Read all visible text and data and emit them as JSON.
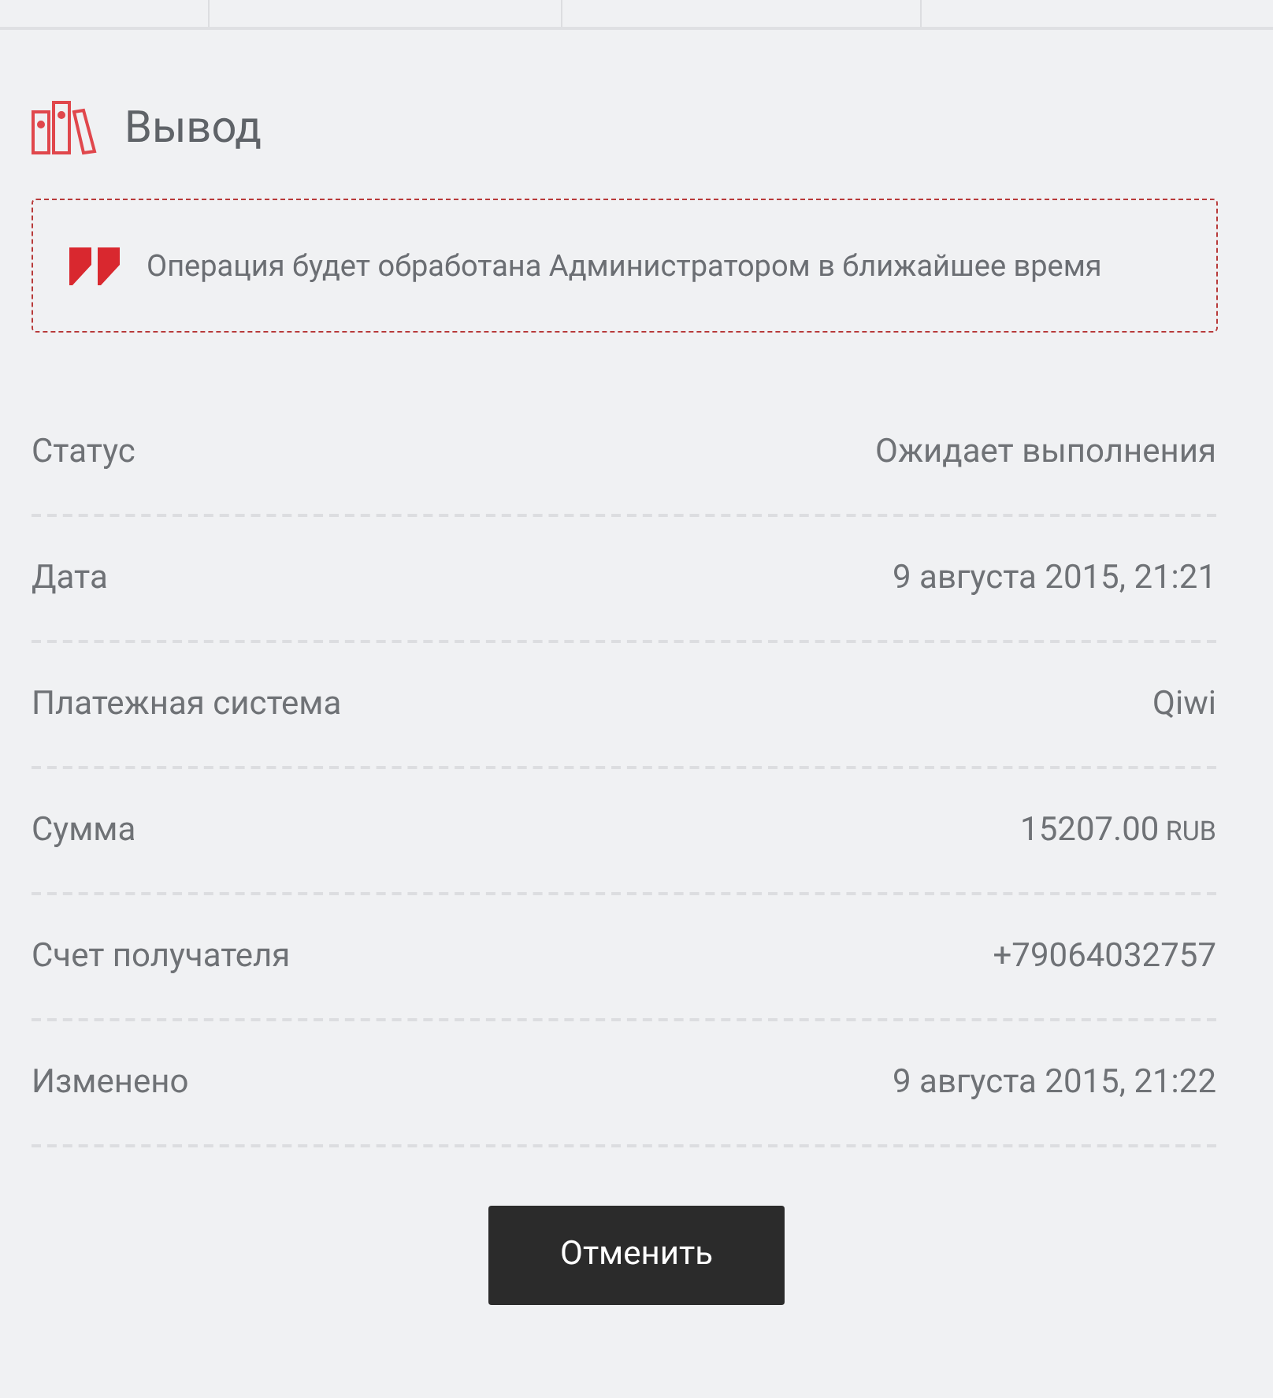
{
  "title": "Вывод",
  "notice": "Операция будет обработана Администратором в ближайшее время",
  "details": [
    {
      "label": "Статус",
      "value": "Ожидает выполнения"
    },
    {
      "label": "Дата",
      "value": "9 августа 2015, 21:21"
    },
    {
      "label": "Платежная система",
      "value": "Qiwi"
    },
    {
      "label": "Сумма",
      "value": "15207.00",
      "unit": "RUB"
    },
    {
      "label": "Счет получателя",
      "value": "+79064032757"
    },
    {
      "label": "Изменено",
      "value": "9 августа 2015, 21:22"
    }
  ],
  "cancel_button": "Отменить"
}
